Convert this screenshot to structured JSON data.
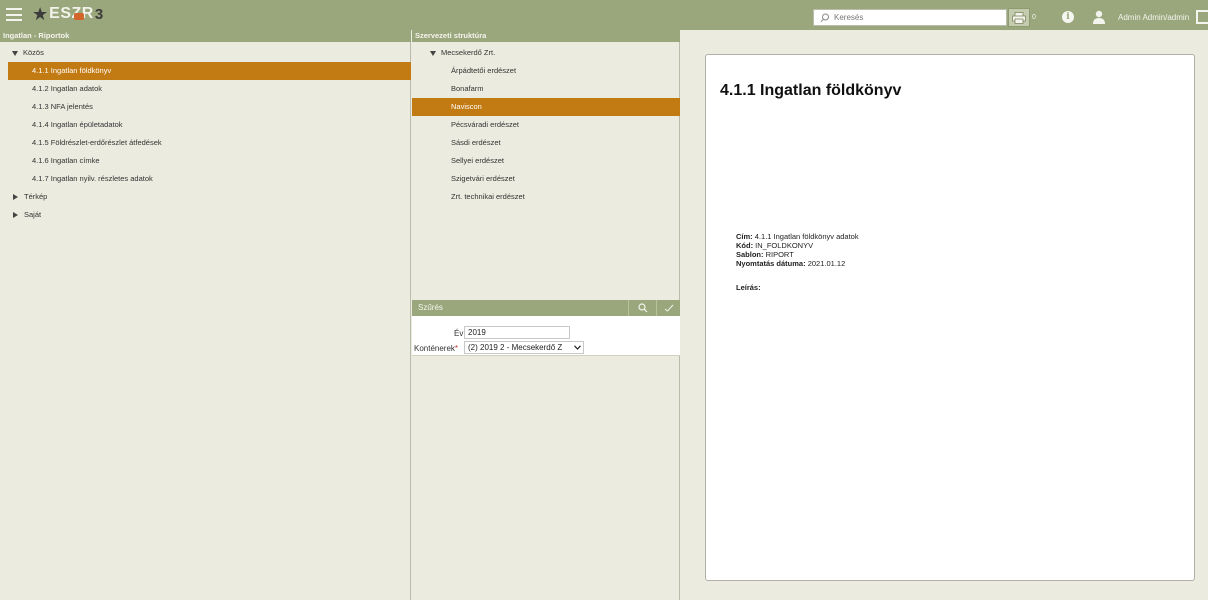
{
  "header": {
    "logo_text": "ESZR",
    "logo_suffix": "3",
    "search_placeholder": "Keresés",
    "print_count": "0",
    "user_name": "Admin Admin/admin"
  },
  "left_panel": {
    "title": "Ingatlan - Riportok",
    "tree": {
      "kozos": "Közös",
      "items": [
        "4.1.1 Ingatlan földkönyv",
        "4.1.2 Ingatlan adatok",
        "4.1.3 NFA jelentés",
        "4.1.4 Ingatlan épületadatok",
        "4.1.5 Földrészlet-erdőrészlet átfedések",
        "4.1.6 Ingatlan címke",
        "4.1.7 Ingatlan nyilv. részletes adatok"
      ],
      "terkep": "Térkép",
      "sajat": "Saját"
    }
  },
  "mid_panel": {
    "title": "Szervezeti struktúra",
    "root": "Mecsekerdő Zrt.",
    "items": [
      "Árpádtetői erdészet",
      "Bonafarm",
      "Naviscon",
      "Pécsváradi erdészet",
      "Sásdi erdészet",
      "Sellyei erdészet",
      "Szigetvári erdészet",
      "Zrt. technikai erdészet"
    ],
    "filter": {
      "title": "Szűrés",
      "ev_label": "Év",
      "ev_value": "2019",
      "kontenerek_label": "Konténerek",
      "required_mark": "*",
      "kontenerek_value": "(2) 2019 2 - Mecsekerdő Z"
    }
  },
  "document": {
    "title": "4.1.1 Ingatlan földkönyv",
    "cim_label": "Cím:",
    "cim_value": "4.1.1 Ingatlan földkönyv adatok",
    "kod_label": "Kód:",
    "kod_value": "IN_FOLDKONYV",
    "sablon_label": "Sablon:",
    "sablon_value": "RIPORT",
    "nyomtatas_label": "Nyomtatás dátuma:",
    "nyomtatas_value": "2021.01.12",
    "leiras_label": "Leírás:"
  },
  "colors": {
    "header_bg": "#9aa77c",
    "selected_bg": "#c27a12",
    "panel_bg": "#ebebdf"
  }
}
